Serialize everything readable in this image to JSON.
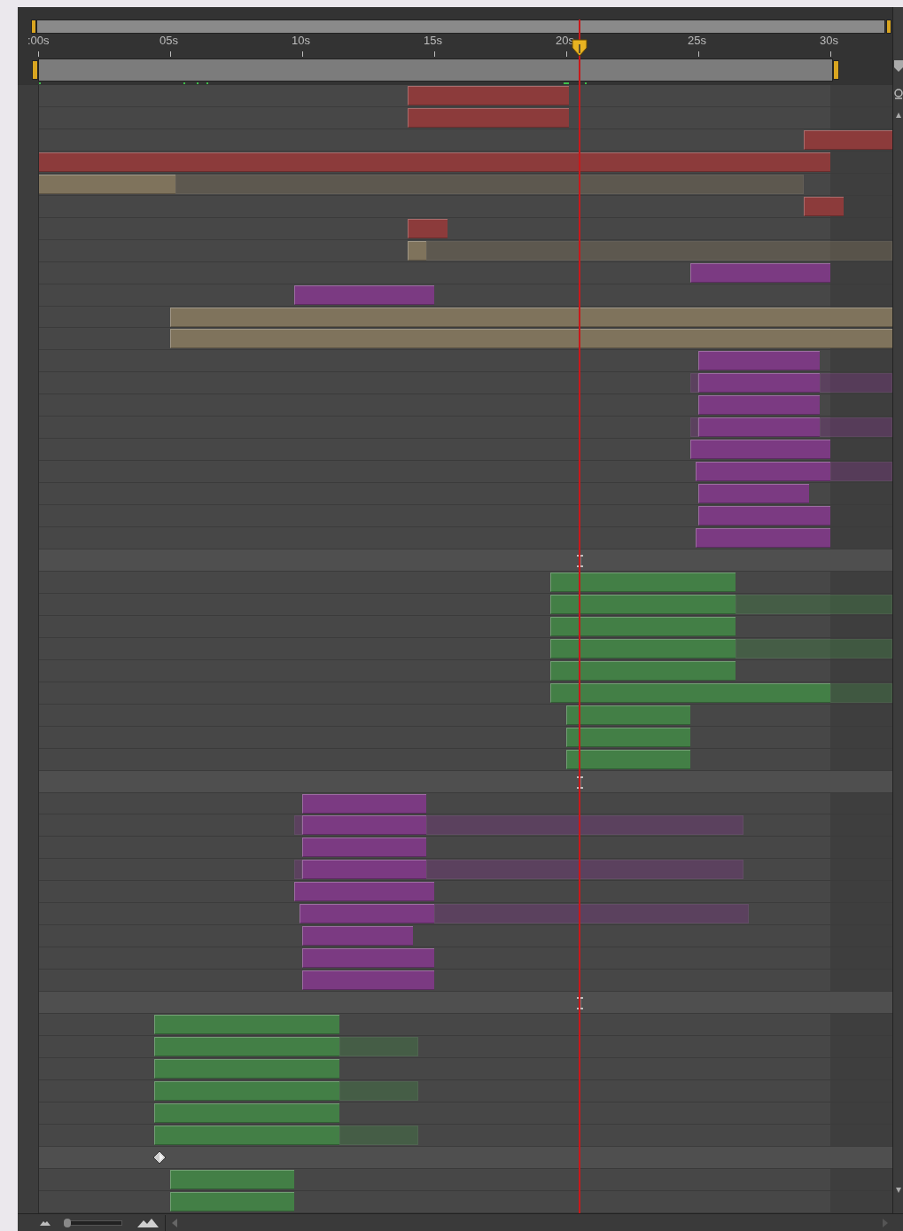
{
  "ruler": {
    "ticks": [
      {
        "label": ":00s"
      },
      {
        "label": "05s"
      },
      {
        "label": "10s"
      },
      {
        "label": "15s"
      },
      {
        "label": "20s"
      },
      {
        "label": "25s"
      },
      {
        "label": "30s"
      }
    ]
  },
  "zoom": {
    "level": 0.05
  },
  "rows": [
    {
      "kind": "layer",
      "color": "#8c3b3b"
    },
    {
      "kind": "layer",
      "color": "#8c3b3b"
    },
    {
      "kind": "layer",
      "color": "#8c3b3b"
    },
    {
      "kind": "layer",
      "color": "#8c3b3b"
    },
    {
      "kind": "layer",
      "color": "#7f735c"
    },
    {
      "kind": "layer",
      "color": "#8c3b3b"
    },
    {
      "kind": "layer",
      "color": "#8c3b3b"
    },
    {
      "kind": "layer",
      "color": "#7f735c"
    },
    {
      "kind": "layer",
      "color": "#7b3a82"
    },
    {
      "kind": "layer",
      "color": "#7b3a82"
    },
    {
      "kind": "layer",
      "color": "#7f735c"
    },
    {
      "kind": "layer",
      "color": "#7f735c"
    },
    {
      "kind": "layer",
      "color": "#7b3a82"
    },
    {
      "kind": "layer",
      "color": "#7b3a82"
    },
    {
      "kind": "layer",
      "color": "#7b3a82"
    },
    {
      "kind": "layer",
      "color": "#7b3a82"
    },
    {
      "kind": "layer",
      "color": "#7b3a82"
    },
    {
      "kind": "layer",
      "color": "#7b3a82"
    },
    {
      "kind": "layer",
      "color": "#7b3a82"
    },
    {
      "kind": "layer",
      "color": "#7b3a82"
    },
    {
      "kind": "layer",
      "color": "#7b3a82"
    },
    {
      "kind": "marker"
    },
    {
      "kind": "layer",
      "color": "#437f46"
    },
    {
      "kind": "layer",
      "color": "#437f46"
    },
    {
      "kind": "layer",
      "color": "#437f46"
    },
    {
      "kind": "layer",
      "color": "#437f46"
    },
    {
      "kind": "layer",
      "color": "#437f46"
    },
    {
      "kind": "layer",
      "color": "#437f46"
    },
    {
      "kind": "layer",
      "color": "#437f46"
    },
    {
      "kind": "layer",
      "color": "#437f46"
    },
    {
      "kind": "layer",
      "color": "#437f46"
    },
    {
      "kind": "marker"
    },
    {
      "kind": "layer",
      "color": "#7b3a82"
    },
    {
      "kind": "layer",
      "color": "#7b3a82"
    },
    {
      "kind": "layer",
      "color": "#7b3a82"
    },
    {
      "kind": "layer",
      "color": "#7b3a82"
    },
    {
      "kind": "layer",
      "color": "#7b3a82"
    },
    {
      "kind": "layer",
      "color": "#7b3a82"
    },
    {
      "kind": "layer",
      "color": "#7b3a82"
    },
    {
      "kind": "layer",
      "color": "#7b3a82"
    },
    {
      "kind": "layer",
      "color": "#7b3a82"
    },
    {
      "kind": "marker"
    },
    {
      "kind": "layer",
      "color": "#437f46"
    },
    {
      "kind": "layer",
      "color": "#437f46"
    },
    {
      "kind": "layer",
      "color": "#437f46"
    },
    {
      "kind": "layer",
      "color": "#437f46"
    },
    {
      "kind": "layer",
      "color": "#437f46"
    },
    {
      "kind": "layer",
      "color": "#437f46"
    },
    {
      "kind": "keyframe"
    },
    {
      "kind": "layer",
      "color": "#437f46"
    },
    {
      "kind": "layer",
      "color": "#437f46"
    }
  ]
}
